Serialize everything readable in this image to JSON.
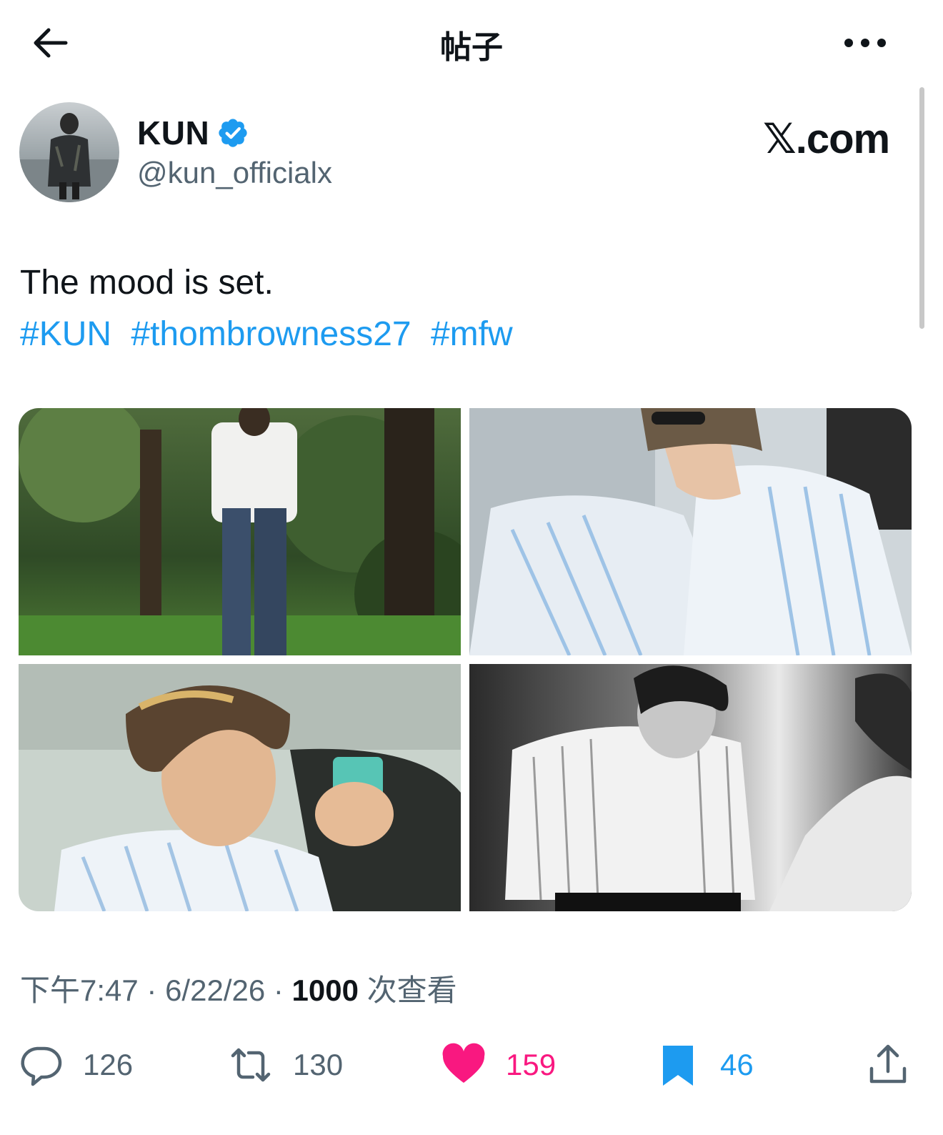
{
  "header": {
    "title": "帖子"
  },
  "author": {
    "name": "KUN",
    "handle": "@kun_officialx",
    "verified": true
  },
  "brand_mark": "𝕏.com",
  "tweet": {
    "text": "The mood is set.",
    "hashtags": [
      "#KUN",
      "#thombrowness27",
      "#mfw"
    ]
  },
  "media": [
    {
      "description": "man in white shirt and wide jeans in garden"
    },
    {
      "description": "man in striped shirt with sunglasses in car"
    },
    {
      "description": "man with wavy highlighted hair holding small device"
    },
    {
      "description": "black and white portrait in striped shirt in elevator"
    }
  ],
  "meta": {
    "time": "下午7:47",
    "date": "6/22/26",
    "views_count": "1000",
    "views_label": "次查看"
  },
  "actions": {
    "replies": "126",
    "reposts": "130",
    "likes": "159",
    "bookmarks": "46"
  },
  "colors": {
    "accent": "#1d9bf0",
    "like": "#f91880",
    "text": "#0f1419",
    "secondary": "#536471"
  }
}
